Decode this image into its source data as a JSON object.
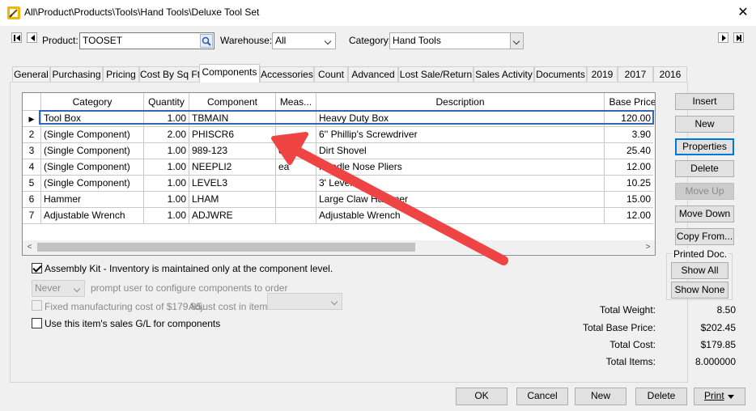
{
  "window": {
    "title": "All\\Product\\Products\\Tools\\Hand Tools\\Deluxe Tool Set",
    "close_glyph": "✕"
  },
  "toolbar": {
    "product_label": "Product:",
    "product_value": "TOOSET",
    "warehouse_label": "Warehouse:",
    "warehouse_value": "All",
    "category_label": "Category:",
    "category_value": "Hand Tools"
  },
  "tabs": [
    {
      "label": "General"
    },
    {
      "label": "Purchasing"
    },
    {
      "label": "Pricing"
    },
    {
      "label": "Cost By Sq Ft"
    },
    {
      "label": "Components"
    },
    {
      "label": "Accessories"
    },
    {
      "label": "Count"
    },
    {
      "label": "Advanced"
    },
    {
      "label": "Lost Sale/Return"
    },
    {
      "label": "Sales Activity"
    },
    {
      "label": "Documents"
    },
    {
      "label": "2019"
    },
    {
      "label": "2017"
    },
    {
      "label": "2016"
    }
  ],
  "active_tab": "Components",
  "grid": {
    "columns": [
      "Category",
      "Quantity",
      "Component",
      "Meas...",
      "Description",
      "Base Price"
    ],
    "rows": [
      {
        "num": "",
        "category": "Tool Box",
        "quantity": "1.00",
        "component": "TBMAIN",
        "measure": "",
        "description": "Heavy Duty Box",
        "base_price": "120.00"
      },
      {
        "num": "2",
        "category": "(Single Component)",
        "quantity": "2.00",
        "component": "PHISCR6",
        "measure": "",
        "description": "6'' Phillip's Screwdriver",
        "base_price": "3.90"
      },
      {
        "num": "3",
        "category": "(Single Component)",
        "quantity": "1.00",
        "component": "989-123",
        "measure": "ea",
        "description": "Dirt Shovel",
        "base_price": "25.40"
      },
      {
        "num": "4",
        "category": "(Single Component)",
        "quantity": "1.00",
        "component": "NEEPLI2",
        "measure": "ea",
        "description": "Needle Nose Pliers",
        "base_price": "12.00"
      },
      {
        "num": "5",
        "category": "(Single Component)",
        "quantity": "1.00",
        "component": "LEVEL3",
        "measure": "",
        "description": "3' Level",
        "base_price": "10.25"
      },
      {
        "num": "6",
        "category": "Hammer",
        "quantity": "1.00",
        "component": "LHAM",
        "measure": "",
        "description": "Large Claw Hammer",
        "base_price": "15.00"
      },
      {
        "num": "7",
        "category": "Adjustable Wrench",
        "quantity": "1.00",
        "component": "ADJWRE",
        "measure": "",
        "description": "Adjustable Wrench",
        "base_price": "12.00"
      }
    ],
    "current_row_glyph": "▶",
    "scroll_left_glyph": "<",
    "scroll_right_glyph": ">"
  },
  "side_buttons": {
    "insert": "Insert",
    "new": "New",
    "properties": "Properties",
    "delete": "Delete",
    "move_up": "Move Up",
    "move_down": "Move Down",
    "copy_from": "Copy From...",
    "printed_doc_label": "Printed Doc.",
    "show_all": "Show All",
    "show_none": "Show None"
  },
  "options": {
    "assembly_kit_label": "Assembly Kit - Inventory is maintained only at the component level.",
    "assembly_kit_checked": true,
    "prompt_select_value": "Never",
    "prompt_label": "prompt user to configure components to order",
    "fixed_cost_label": "Fixed manufacturing cost of $179.85.",
    "adjust_cost_label": "Adjust cost in item:",
    "sales_gl_label": "Use this item's sales G/L for components",
    "sales_gl_checked": false
  },
  "totals": {
    "weight_label": "Total Weight:",
    "weight_value": "8.50",
    "base_price_label": "Total Base Price:",
    "base_price_value": "$202.45",
    "cost_label": "Total Cost:",
    "cost_value": "$179.85",
    "items_label": "Total Items:",
    "items_value": "8.000000"
  },
  "footer": {
    "ok": "OK",
    "cancel": "Cancel",
    "new": "New",
    "delete": "Delete",
    "print": "Print"
  },
  "colors": {
    "annotation_arrow": "#ef4444",
    "selection_outline": "#2f67b4"
  }
}
